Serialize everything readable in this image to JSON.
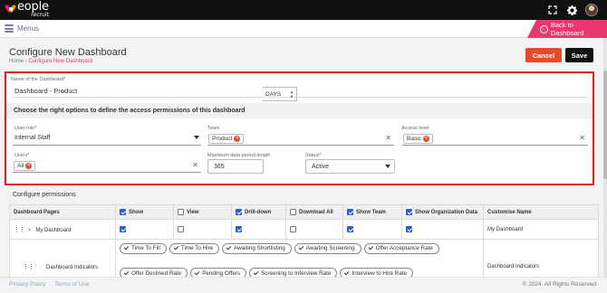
{
  "app": {
    "logo_text": "eople",
    "logo_sub": "recruit"
  },
  "topbar": {
    "fullscreen_icon": "expand-icon",
    "settings_icon": "gear-icon",
    "avatar_icon": "user-avatar"
  },
  "menubar": {
    "label": "Menus",
    "back_label": "Back to Dashboard"
  },
  "page": {
    "title": "Configure New Dashboard",
    "breadcrumb_home": "Home",
    "breadcrumb_sep": " › ",
    "breadcrumb_current": "Configure New Dashboard",
    "cancel_label": "Cancel",
    "save_label": "Save"
  },
  "form": {
    "name_label": "Name of the Dashboard*",
    "name_value": "Dashboard - Product",
    "permissions_heading": "Choose the right options to define the access permissions of this dashboard",
    "user_role_label": "User role*",
    "user_role_value": "Internal Staff",
    "team_label": "Team",
    "team_chip": "Product",
    "access_level_label": "Access level",
    "access_level_chip": "Basic",
    "users_label": "Users*",
    "users_chip": "All",
    "max_period_label": "Maximum data period length",
    "max_period_value": "365",
    "max_period_unit": "DAYS",
    "status_label": "Status*",
    "status_value": "Active"
  },
  "permissions": {
    "title": "Configure permissions",
    "columns": [
      {
        "label": "Dashboard Pages",
        "checkbox": null
      },
      {
        "label": "Show",
        "checkbox": true
      },
      {
        "label": "View",
        "checkbox": false
      },
      {
        "label": "Drill-down",
        "checkbox": true
      },
      {
        "label": "Download All",
        "checkbox": false
      },
      {
        "label": "Show Team",
        "checkbox": true
      },
      {
        "label": "Show Organization Data",
        "checkbox": true
      },
      {
        "label": "Customise Name",
        "checkbox": null
      }
    ],
    "row1": {
      "page": "My Dashboard",
      "show": true,
      "view": false,
      "drilldown": true,
      "download": false,
      "show_team": true,
      "show_org": true,
      "custom_name": "My Dashboard"
    },
    "row2": {
      "page": "Dashboard Indicators",
      "custom_name": "Dashboard Indicators",
      "indicators": [
        "Time To Fill",
        "Time To Hire",
        "Awaiting Shortlisting",
        "Awaiting Screening",
        "Offer Acceptance Rate",
        "Offer Declined Rate",
        "Pending Offers",
        "Screening to Interview Rate",
        "Interview to Hire Rate"
      ]
    }
  },
  "footer": {
    "privacy": "Privacy Policy",
    "terms": "Terms of Use",
    "copyright": "© 2024. All Rights Reserved"
  },
  "colors": {
    "accent_pink": "#e8386d",
    "cancel_red": "#e34b2a",
    "highlight_border": "#e01b1b",
    "checkbox_blue": "#2f5fc8"
  }
}
